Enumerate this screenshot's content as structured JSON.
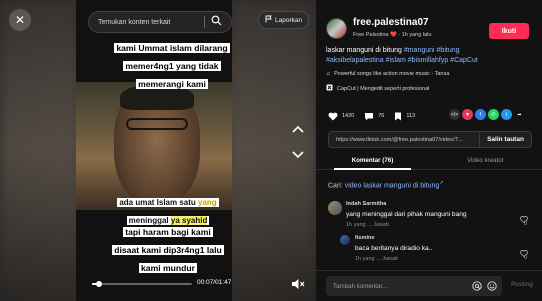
{
  "player": {
    "search_placeholder": "Temukan konten terkait",
    "report_label": "Laporkan",
    "overlay_top": [
      "kami Ummat islam dilarang",
      "memer4ng1 yang tidak",
      "memerangi kami"
    ],
    "overlay_mid": {
      "prefix": "ada umat Islam satu ",
      "highlight_1": "yang",
      "line2_prefix": "meninggal ",
      "highlight_2": "ya syahid"
    },
    "overlay_bottom": [
      "tapi haram bagi kami",
      "disaat kami dip3r4ng1 lalu",
      "kami mundur"
    ],
    "time": "00:07/01:47",
    "progress": 0.07
  },
  "author": {
    "username": "free.palestina07",
    "bio": "Free Palestina ❤️ · 1h yang lalu",
    "follow_label": "Ikuti"
  },
  "caption": {
    "text": "laskar manguni di bitung ",
    "tags": [
      "#manguni",
      "#bitung",
      "#aksibelapalestina",
      "#islam",
      "#bismillahfyp",
      "#CapCut"
    ]
  },
  "music": "Powerful songs like action movie music - Tansa",
  "capcut": "CapCut | Mengedit seperti profesional",
  "stats": {
    "likes": "1420",
    "comments": "76",
    "saves": "113"
  },
  "share_colors": [
    "#e03a5a",
    "#2a7ff0",
    "#25d366",
    "#1d9bf0",
    "#ffffff"
  ],
  "link": {
    "url": "https://www.tiktok.com/@free.palestina07/video/7...",
    "copy_label": "Salin tautan"
  },
  "tabs": {
    "comments": "Komentar (76)",
    "creator": "Video kreator"
  },
  "search_suggest": {
    "prefix": "Cari: ",
    "query": "video laskar manguni di bitung"
  },
  "comments": [
    {
      "name": "Indah Sarmitha",
      "text": "yang meninggal dari pihak manguni bang",
      "meta": "1h yang ...   Jawab",
      "likes": "0"
    },
    {
      "name": "Itsmine",
      "text": "baca beritanya diradio ka..",
      "meta": "1h yang ...   Jawab",
      "likes": "0"
    }
  ],
  "composer": {
    "placeholder": "Tambah komentar...",
    "post_label": "Posting"
  }
}
